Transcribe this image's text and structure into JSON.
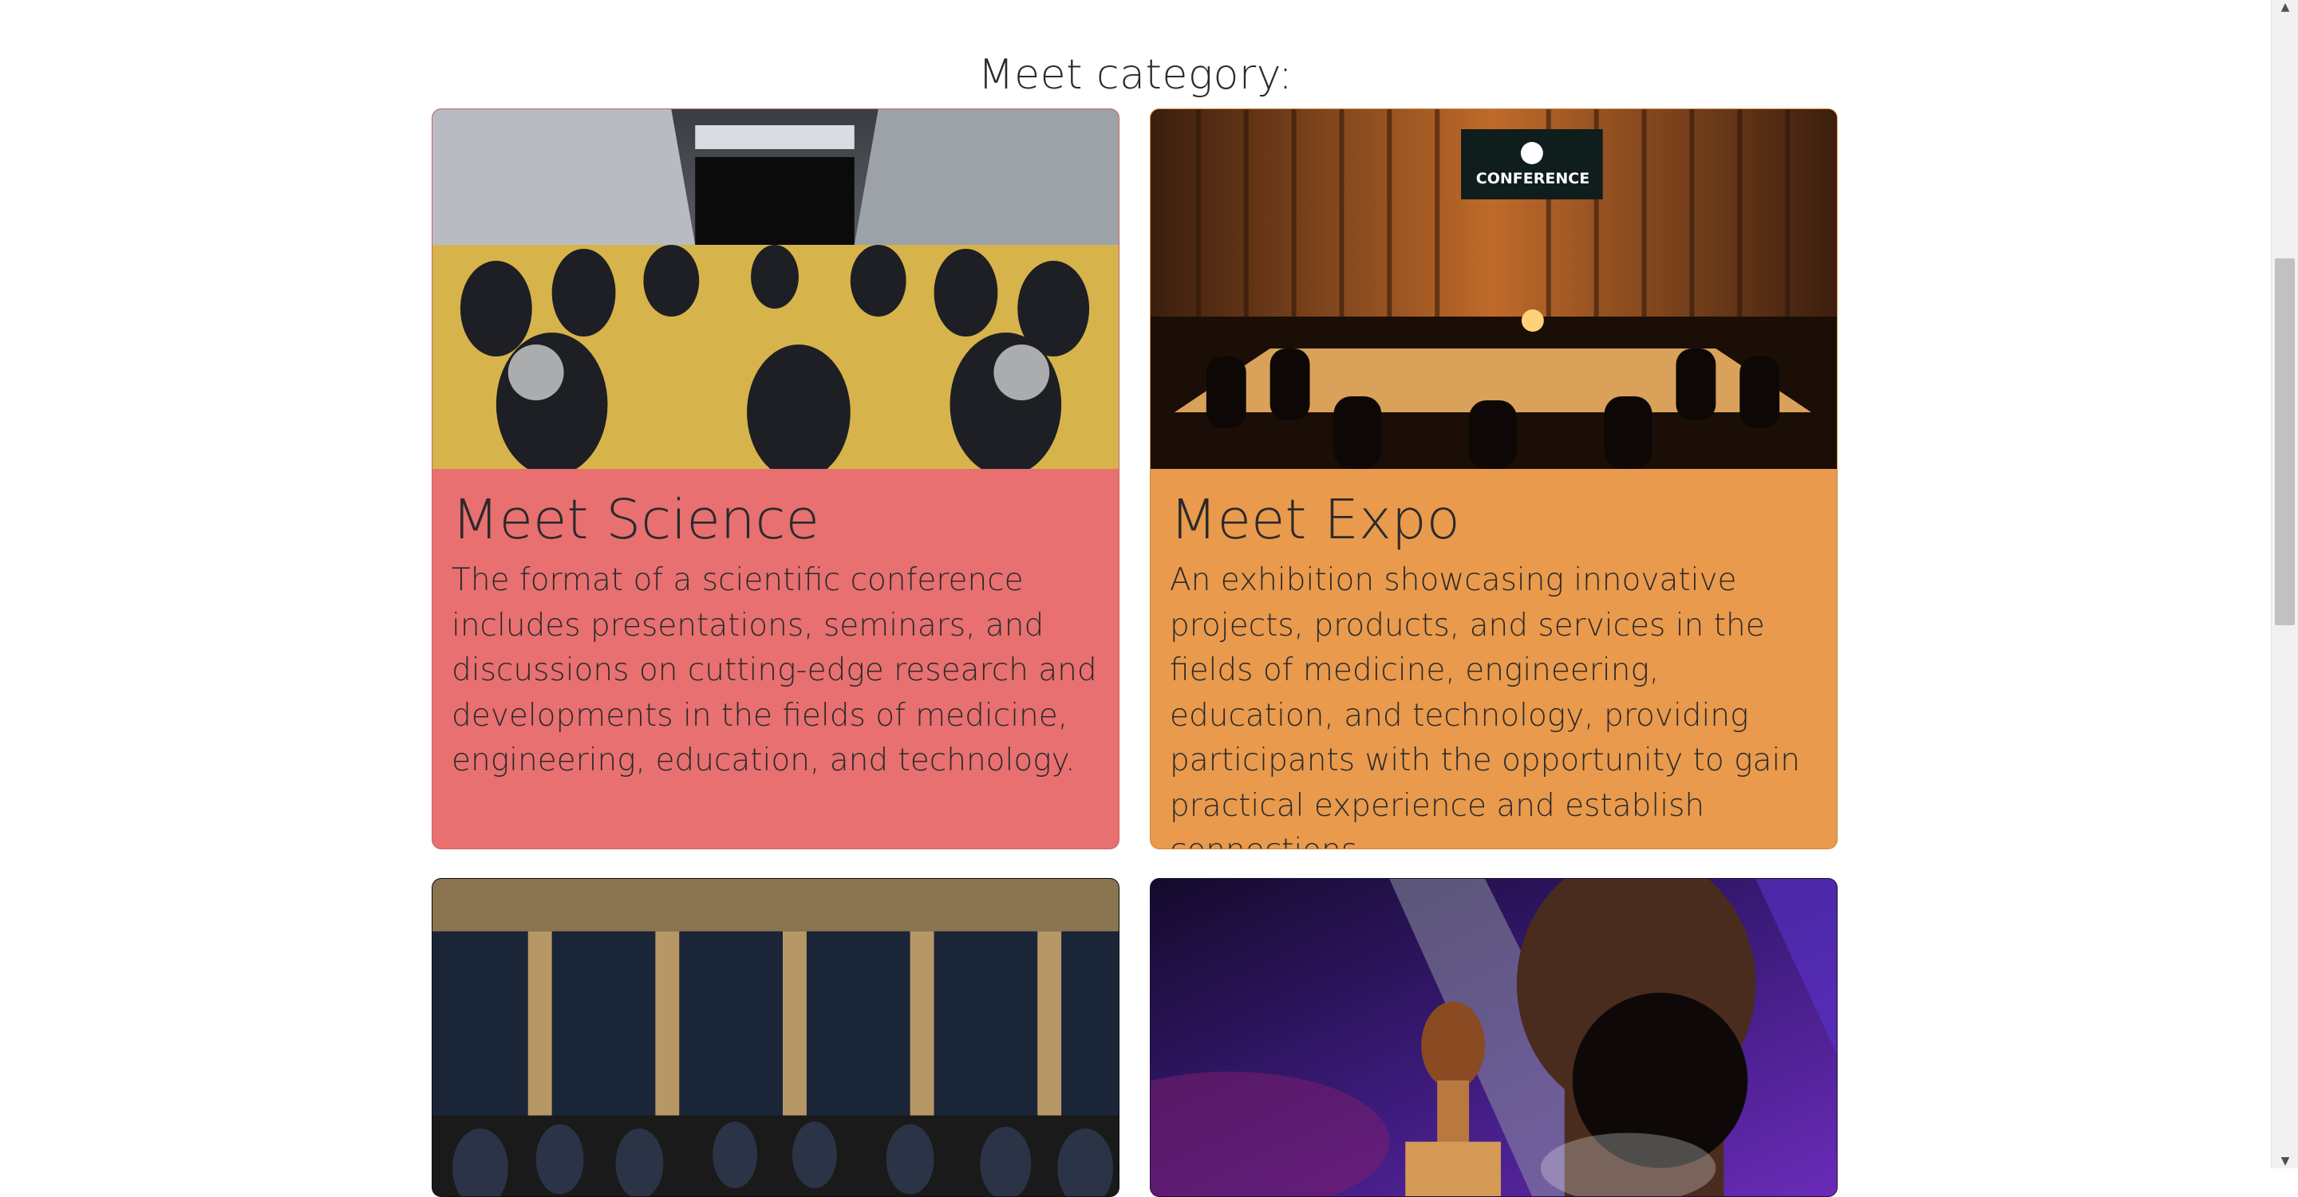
{
  "section": {
    "title": "Meet category:"
  },
  "cards": [
    {
      "title": "Meet Science",
      "text": "The format of a scientific conference includes presentations, seminars, and discussions on cutting-edge research and developments in the fields of medicine, engineering, education, and technology.",
      "color": "#e87070",
      "image": "auditorium-audience-image"
    },
    {
      "title": "Meet Expo",
      "text": "An exhibition showcasing innovative projects, products, and services in the fields of medicine, engineering, education, and technology, providing participants with the opportunity to gain practical experience and establish connections.",
      "color": "#e99a4c",
      "image": "conference-table-image",
      "sign_text": "CONFERENCE"
    },
    {
      "image": "meeting-hall-image"
    },
    {
      "image": "artist-grammy-portrait-image"
    }
  ],
  "scrollbar": {
    "up_icon": "arrow-up-icon",
    "down_icon": "arrow-down-icon"
  }
}
